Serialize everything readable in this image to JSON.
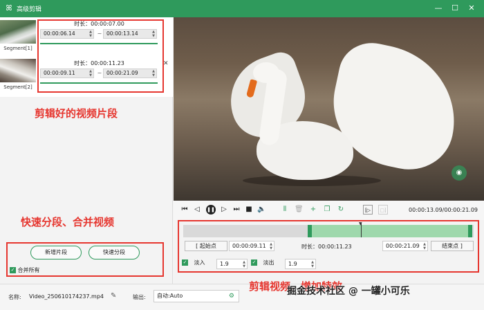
{
  "window": {
    "title": "高级剪辑",
    "minimize": "—",
    "maximize": "☐",
    "close": "✕"
  },
  "segments": [
    {
      "label": "Segment[1]",
      "duration": "时长：00:00:07.00",
      "start": "00:00:06.14",
      "end": "00:00:13.14"
    },
    {
      "label": "Segment[2]",
      "duration": "时长：00:00:11.23",
      "start": "00:00:09.11",
      "end": "00:00:21.09"
    }
  ],
  "annotations": {
    "clips": "剪辑好的视频片段",
    "split": "快速分段、合并视频",
    "edit": "剪辑视频，增加特效"
  },
  "left_buttons": {
    "add": "新增片段",
    "quick_split": "快速分段",
    "merge_all": "合并所有"
  },
  "player": {
    "timecode": "00:00:13.09/00:00:21.09"
  },
  "trim": {
    "start_button": "起始点",
    "start_value": "00:00:09.11",
    "duration": "时长：00:00:11.23",
    "end_value": "00:00:21.09",
    "end_button": "结束点"
  },
  "fade": {
    "in_label": "淡入",
    "in_value": "1.9",
    "out_label": "淡出",
    "out_value": "1.9"
  },
  "bottom": {
    "name_label": "名称:",
    "file_name": "Video_250610174237.mp4",
    "output_label": "输出:",
    "output_value": "自动:Auto"
  },
  "watermark": "掘金技术社区 @ 一罐小可乐",
  "colors": {
    "accent": "#2f9a5c",
    "annotation": "#e6362f"
  }
}
